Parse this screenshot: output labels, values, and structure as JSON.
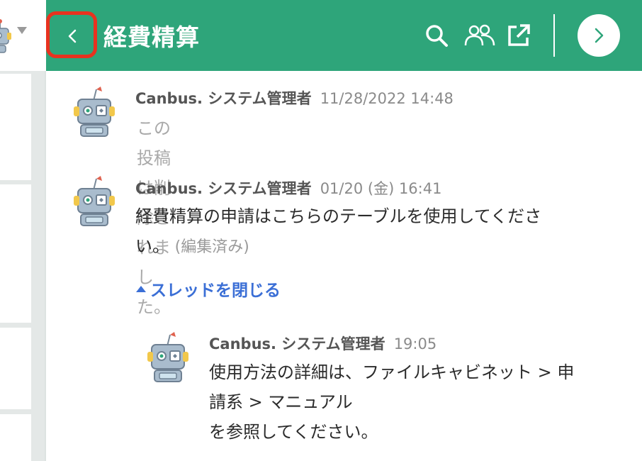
{
  "header": {
    "title": "経費精算",
    "back_icon": "chevron-left-icon",
    "search_icon": "search-icon",
    "members_icon": "members-icon",
    "popout_icon": "external-link-icon",
    "forward_icon": "chevron-right-icon",
    "bg_color": "#2ea57a",
    "highlight_color": "#e8321f"
  },
  "messages": [
    {
      "author": "Canbus. システム管理者",
      "time": "11/28/2022 14:48",
      "text": "この投稿は削除されました。"
    },
    {
      "author": "Canbus. システム管理者",
      "time": "01/20 (金) 16:41",
      "text_line1": "経費精算の申請はこちらのテーブルを使用してくださ",
      "text_line2": "い。",
      "edited": "(編集済み)"
    }
  ],
  "thread": {
    "toggle_label": "スレッドを閉じる",
    "link_color": "#3b6fd6",
    "reply": {
      "author": "Canbus. システム管理者",
      "time": "19:05",
      "line1": "使用方法の詳細は、ファイルキャビネット > 申",
      "line2": "請系 > マニュアル",
      "line3": "を参照してください。"
    }
  }
}
